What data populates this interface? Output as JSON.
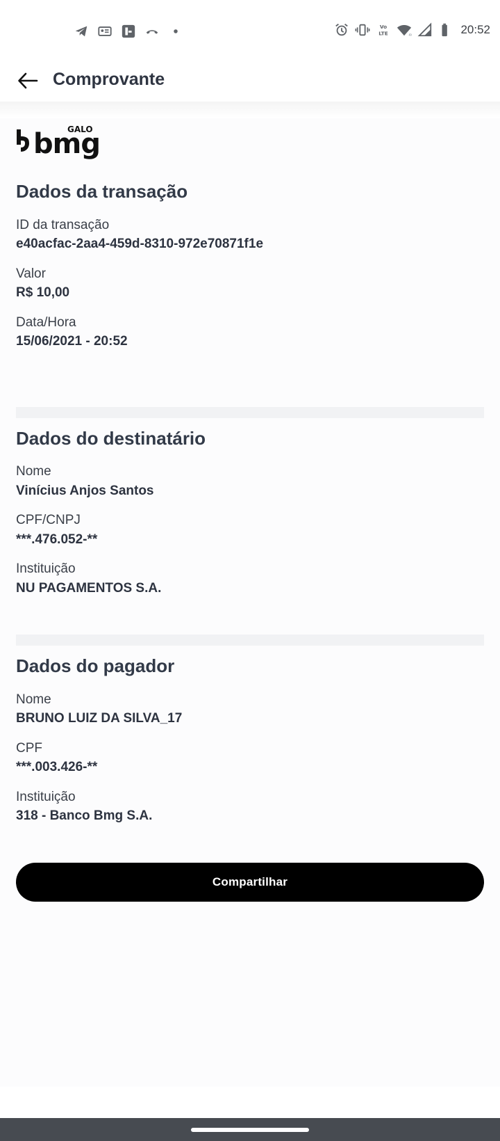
{
  "status_bar": {
    "time": "20:52",
    "left_icons": [
      "telegram-icon",
      "id-card-icon",
      "app-badge-icon",
      "missed-call-icon",
      "dot-icon"
    ],
    "right_icons": [
      "alarm-icon",
      "vibrate-icon",
      "volte-icon",
      "wifi-icon",
      "signal-icon",
      "battery-icon"
    ],
    "volte_text": "Vo LTE",
    "network_text": "4G"
  },
  "app_bar": {
    "back_icon": "arrow-left-icon",
    "title": "Comprovante"
  },
  "logo": {
    "tag": "GALO",
    "brand": "bmg"
  },
  "transaction": {
    "title": "Dados da transação",
    "id_label": "ID da transação",
    "id_value": "e40acfac-2aa4-459d-8310-972e70871f1e",
    "amount_label": "Valor",
    "amount_value": "R$ 10,00",
    "datetime_label": "Data/Hora",
    "datetime_value": "15/06/2021 - 20:52"
  },
  "recipient": {
    "title": "Dados do destinatário",
    "name_label": "Nome",
    "name_value": "Vinícius Anjos Santos",
    "doc_label": "CPF/CNPJ",
    "doc_value": "***.476.052-**",
    "institution_label": "Instituição",
    "institution_value": "NU PAGAMENTOS S.A."
  },
  "payer": {
    "title": "Dados do pagador",
    "name_label": "Nome",
    "name_value": "BRUNO LUIZ DA SILVA_17",
    "doc_label": "CPF",
    "doc_value": "***.003.426-**",
    "institution_label": "Instituição",
    "institution_value": "318 - Banco Bmg S.A."
  },
  "actions": {
    "share_label": "Compartilhar"
  },
  "colors": {
    "text_primary": "#2f3542",
    "button_bg": "#000000",
    "button_text": "#ffffff",
    "divider": "#f1f2f4",
    "nav_bar": "#474b51"
  }
}
